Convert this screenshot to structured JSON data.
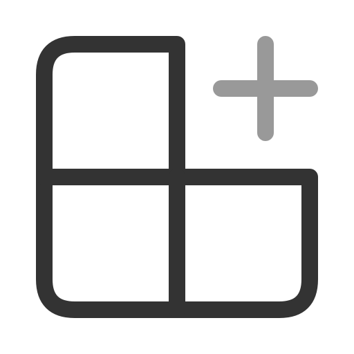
{
  "icon": {
    "name": "add-app-icon",
    "primary_color": "#333333",
    "accent_color": "#999999"
  }
}
